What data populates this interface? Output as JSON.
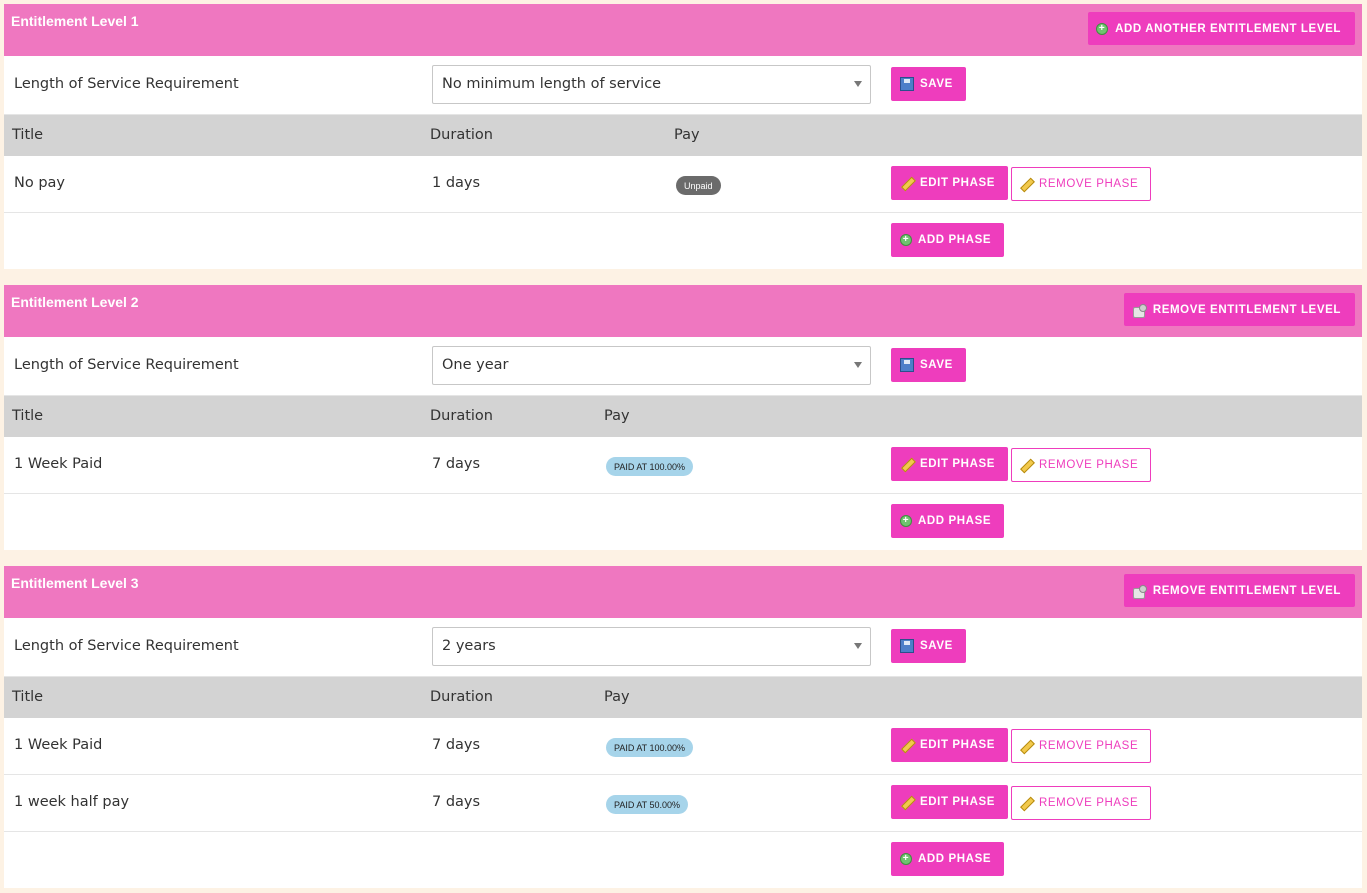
{
  "levels": [
    {
      "title": "Entitlement Level 1",
      "header_button": {
        "label": "ADD ANOTHER ENTITLEMENT LEVEL",
        "icon": "add-icon"
      },
      "los_label": "Length of Service Requirement",
      "los_value": "No minimum length of service",
      "save_label": "SAVE",
      "columns": {
        "title": "Title",
        "duration": "Duration",
        "pay": "Pay"
      },
      "phases": [
        {
          "title": "No pay",
          "duration": "1 days",
          "pay": "Unpaid",
          "pay_type": "unpaid"
        }
      ],
      "edit_label": "EDIT PHASE",
      "remove_label": "REMOVE PHASE",
      "add_label": "ADD PHASE"
    },
    {
      "title": "Entitlement Level 2",
      "header_button": {
        "label": "REMOVE ENTITLEMENT LEVEL",
        "icon": "delete-icon"
      },
      "los_label": "Length of Service Requirement",
      "los_value": "One year",
      "save_label": "SAVE",
      "columns": {
        "title": "Title",
        "duration": "Duration",
        "pay": "Pay"
      },
      "phases": [
        {
          "title": "1 Week Paid",
          "duration": "7 days",
          "pay": "PAID AT 100.00%",
          "pay_type": "paid"
        }
      ],
      "edit_label": "EDIT PHASE",
      "remove_label": "REMOVE PHASE",
      "add_label": "ADD PHASE"
    },
    {
      "title": "Entitlement Level 3",
      "header_button": {
        "label": "REMOVE ENTITLEMENT LEVEL",
        "icon": "delete-icon"
      },
      "los_label": "Length of Service Requirement",
      "los_value": "2 years",
      "save_label": "SAVE",
      "columns": {
        "title": "Title",
        "duration": "Duration",
        "pay": "Pay"
      },
      "phases": [
        {
          "title": "1 Week Paid",
          "duration": "7 days",
          "pay": "PAID AT 100.00%",
          "pay_type": "paid"
        },
        {
          "title": "1 week half pay",
          "duration": "7 days",
          "pay": "PAID AT 50.00%",
          "pay_type": "paid"
        }
      ],
      "edit_label": "EDIT PHASE",
      "remove_label": "REMOVE PHASE",
      "add_label": "ADD PHASE"
    }
  ],
  "colors": {
    "header_bg": "#ef77c0",
    "button_bg": "#ee3dbd",
    "table_head_bg": "#d3d3d3",
    "unpaid_badge": "#6b6b6b",
    "paid_badge": "#a6d4ea",
    "page_bg": "#fdf2e4"
  }
}
